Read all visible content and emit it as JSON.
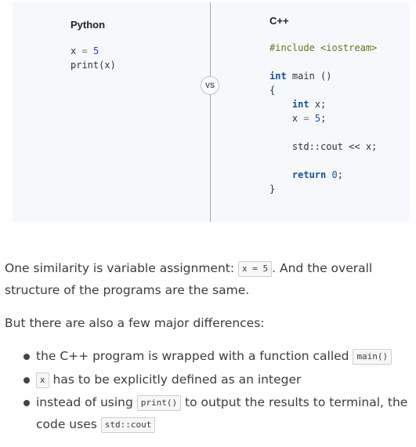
{
  "comparison": {
    "left": {
      "heading": "Python",
      "code": {
        "l1_var": "x",
        "l1_op": "=",
        "l1_num": "5",
        "l2": "print(x)"
      }
    },
    "badge": "VS",
    "right": {
      "heading": "C++",
      "code": {
        "include": "#include <iostream>",
        "main_kw": "int",
        "main_sig": " main ()",
        "open_brace": "{",
        "decl_kw": "int",
        "decl_rest": " x;",
        "assign_var": "x",
        "assign_op": "=",
        "assign_num": "5",
        "assign_end": ";",
        "cout": "std::cout << x;",
        "return_kw": "return",
        "return_num": "0",
        "return_end": ";",
        "close_brace": "}"
      }
    }
  },
  "prose": {
    "similarity_before": "One similarity is variable assignment: ",
    "similarity_code": "x = 5",
    "similarity_after": ". And the overall structure of the programs are the same.",
    "differences_intro": "But there are also a few major differences:",
    "bullets": [
      {
        "before": "the C++ program is wrapped with a function called ",
        "code": "main()",
        "after": ""
      },
      {
        "before": "",
        "code": "x",
        "after": " has to be explicitly defined as an integer"
      },
      {
        "before": "instead of using ",
        "code": "print()",
        "after": " to output the results to terminal, the code uses ",
        "code2": "std::cout"
      }
    ]
  }
}
